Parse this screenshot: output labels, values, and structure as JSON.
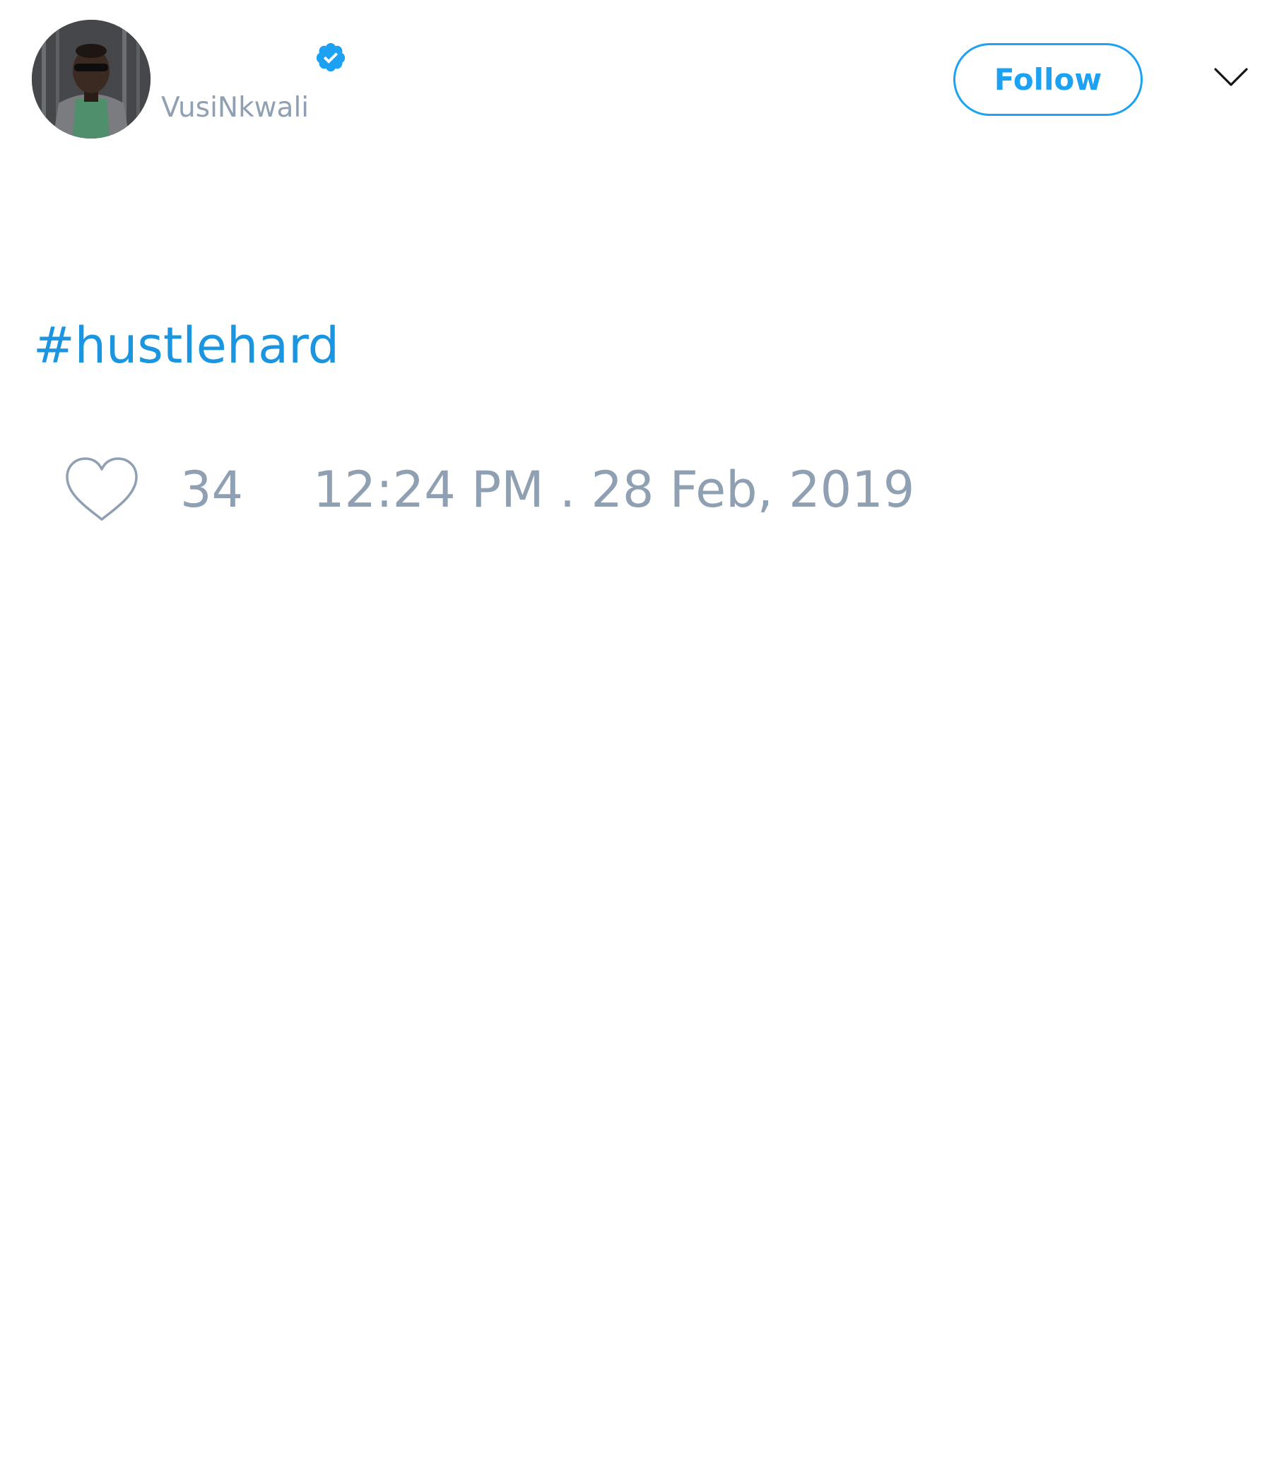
{
  "tweet": {
    "author": {
      "handle": "VusiNkwali",
      "verified": true,
      "avatar_icon": "user-avatar-photo"
    },
    "follow_label": "Follow",
    "menu_icon": "chevron-down-icon",
    "body": {
      "hashtag": "#hustlehard"
    },
    "likes": {
      "icon": "heart-icon",
      "count": "34"
    },
    "timestamp": "12:24 PM . 28 Feb, 2019"
  },
  "colors": {
    "accent": "#1da1f2",
    "hashtag": "#1b95e0",
    "muted": "#8fa0b3",
    "background": "#ffffff"
  }
}
